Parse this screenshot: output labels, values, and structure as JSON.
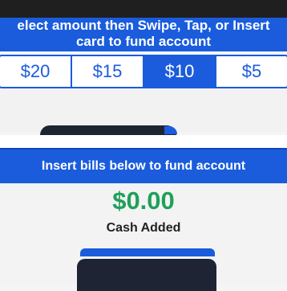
{
  "card_panel": {
    "header_line1": "elect amount then Swipe, Tap, or Insert",
    "header_line2": "card to fund account",
    "amounts": [
      {
        "label": "$20",
        "selected": false
      },
      {
        "label": "$15",
        "selected": false
      },
      {
        "label": "$10",
        "selected": true
      },
      {
        "label": "$5",
        "selected": false
      }
    ]
  },
  "cash_panel": {
    "header": "Insert bills below to fund account",
    "amount": "$0.00",
    "amount_label": "Cash Added"
  },
  "colors": {
    "primary": "#1a5cdc",
    "success": "#1fa05a",
    "dark": "#1e2434"
  }
}
